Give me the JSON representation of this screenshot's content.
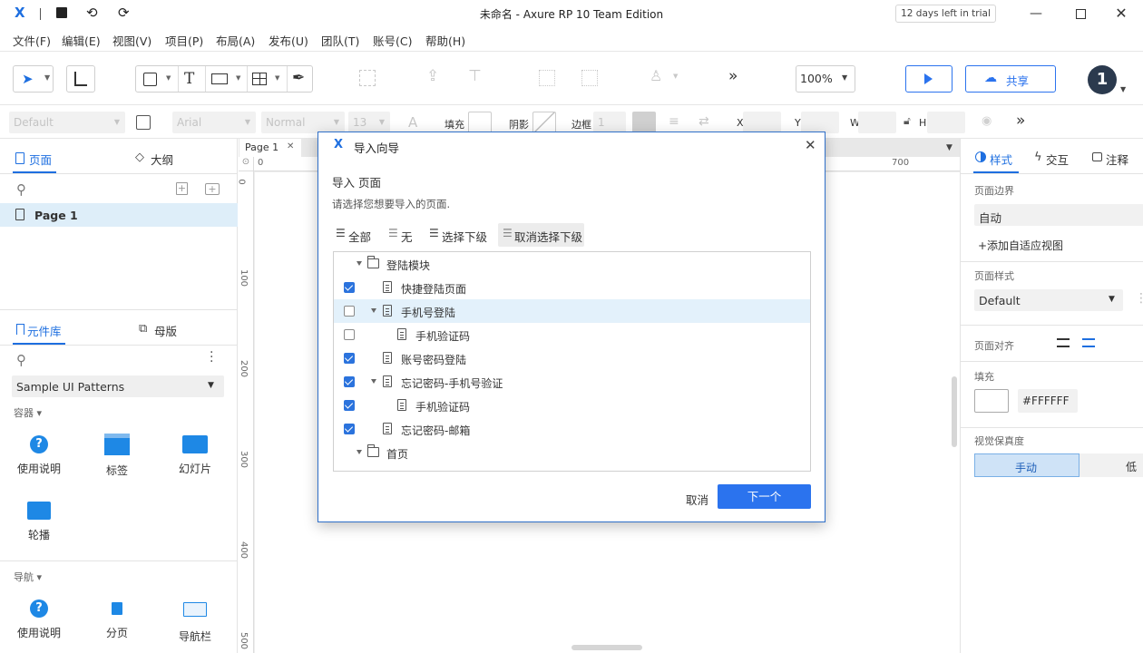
{
  "window": {
    "title": "未命名 - Axure RP 10 Team Edition",
    "trial": "12 days left in trial",
    "logo": "X"
  },
  "menu": [
    "文件(F)",
    "编辑(E)",
    "视图(V)",
    "项目(P)",
    "布局(A)",
    "发布(U)",
    "团队(T)",
    "账号(C)",
    "帮助(H)"
  ],
  "toolbar": {
    "zoom": "100%",
    "share_label": "共享",
    "avatar": "1",
    "more": "»"
  },
  "stylebar": {
    "style": "Default",
    "font": "Arial",
    "weight": "Normal",
    "size": "13",
    "fill_label": "填充",
    "shadow_label": "阴影",
    "border_label": "边框",
    "border_value": "1",
    "x_label": "X",
    "y_label": "Y",
    "w_label": "W",
    "h_label": "H"
  },
  "left": {
    "pages_tab": "页面",
    "outline_tab": "大纲",
    "page_item": "Page 1",
    "library_tab": "元件库",
    "masters_tab": "母版",
    "library_select": "Sample UI Patterns",
    "section_container": "容器",
    "widgets_container": [
      "使用说明",
      "标签",
      "幻灯片",
      "轮播"
    ],
    "section_nav": "导航",
    "widgets_nav": [
      "使用说明",
      "分页",
      "导航栏"
    ]
  },
  "canvas": {
    "tab": "Page 1",
    "ruler_h": [
      "0",
      "700"
    ],
    "ruler_v": [
      "0",
      "100",
      "200",
      "300",
      "400",
      "500"
    ]
  },
  "right": {
    "style_tab": "样式",
    "interact_tab": "交互",
    "notes_tab": "注释",
    "page_border_label": "页面边界",
    "page_border_value": "自动",
    "add_adaptive": "+添加自适应视图",
    "page_style_label": "页面样式",
    "page_style_value": "Default",
    "align_label": "页面对齐",
    "fill_label": "填充",
    "fill_color": "#FFFFFF",
    "fidelity_label": "视觉保真度",
    "fidelity_manual": "手动",
    "fidelity_low": "低"
  },
  "dialog": {
    "title": "导入向导",
    "heading": "导入 页面",
    "desc": "请选择您想要导入的页面.",
    "btn_all": "全部",
    "btn_none": "无",
    "btn_select_children": "选择下级",
    "btn_deselect_children": "取消选择下级",
    "tree": [
      {
        "label": "登陆模块",
        "type": "folder",
        "checked": null
      },
      {
        "label": "快捷登陆页面",
        "type": "page",
        "checked": true
      },
      {
        "label": "手机号登陆",
        "type": "page",
        "checked": false
      },
      {
        "label": "手机验证码",
        "type": "page",
        "checked": false
      },
      {
        "label": "账号密码登陆",
        "type": "page",
        "checked": true
      },
      {
        "label": "忘记密码-手机号验证",
        "type": "page",
        "checked": true
      },
      {
        "label": "手机验证码",
        "type": "page",
        "checked": true
      },
      {
        "label": "忘记密码-邮箱",
        "type": "page",
        "checked": true
      },
      {
        "label": "首页",
        "type": "folder",
        "checked": null
      }
    ],
    "cancel": "取消",
    "next": "下一个"
  },
  "colors": {
    "accent": "#1e6fe0",
    "primary_button": "#2b73ee",
    "highlight_row": "#e3f1fb",
    "avatar": "#2b3a4e"
  }
}
